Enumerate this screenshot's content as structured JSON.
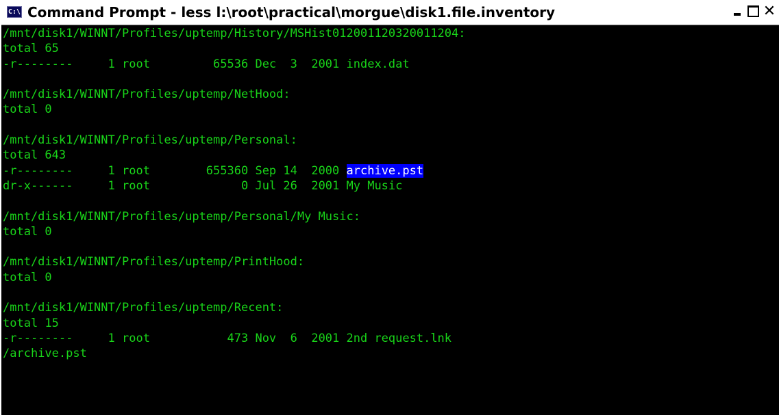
{
  "window": {
    "icon_text": "C:\\",
    "title": "Command Prompt - less l:\\root\\practical\\morgue\\disk1.file.inventory",
    "controls": {
      "minimize": "_",
      "maximize": "□",
      "close": "×"
    }
  },
  "colors": {
    "terminal_background": "#000000",
    "terminal_text": "#19d419",
    "highlight_background": "#0000ff",
    "highlight_text": "#ffffff"
  },
  "terminal": {
    "lines": [
      {
        "text": "/mnt/disk1/WINNT/Profiles/uptemp/History/MSHist012001120320011204:"
      },
      {
        "text": "total 65"
      },
      {
        "text": "-r--------     1 root         65536 Dec  3  2001 index.dat"
      },
      {
        "text": ""
      },
      {
        "text": "/mnt/disk1/WINNT/Profiles/uptemp/NetHood:"
      },
      {
        "text": "total 0"
      },
      {
        "text": ""
      },
      {
        "text": "/mnt/disk1/WINNT/Profiles/uptemp/Personal:"
      },
      {
        "text": "total 643"
      },
      {
        "text": "-r--------     1 root        655360 Sep 14  2000 ",
        "highlight": "archive.pst"
      },
      {
        "text": "dr-x------     1 root             0 Jul 26  2001 My Music"
      },
      {
        "text": ""
      },
      {
        "text": "/mnt/disk1/WINNT/Profiles/uptemp/Personal/My Music:"
      },
      {
        "text": "total 0"
      },
      {
        "text": ""
      },
      {
        "text": "/mnt/disk1/WINNT/Profiles/uptemp/PrintHood:"
      },
      {
        "text": "total 0"
      },
      {
        "text": ""
      },
      {
        "text": "/mnt/disk1/WINNT/Profiles/uptemp/Recent:"
      },
      {
        "text": "total 15"
      },
      {
        "text": "-r--------     1 root           473 Nov  6  2001 2nd request.lnk"
      },
      {
        "text": "/archive.pst"
      }
    ]
  }
}
